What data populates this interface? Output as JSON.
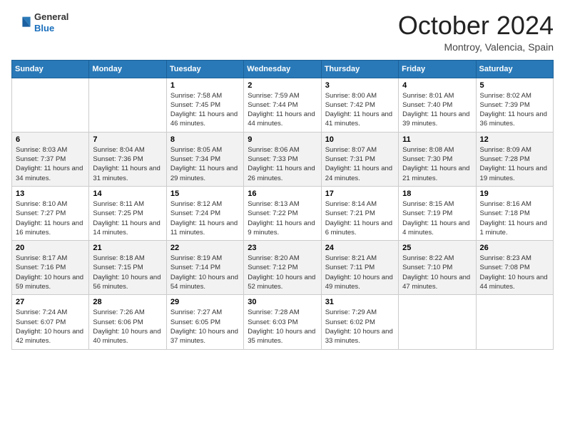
{
  "header": {
    "logo_general": "General",
    "logo_blue": "Blue",
    "month_title": "October 2024",
    "location": "Montroy, Valencia, Spain"
  },
  "weekdays": [
    "Sunday",
    "Monday",
    "Tuesday",
    "Wednesday",
    "Thursday",
    "Friday",
    "Saturday"
  ],
  "weeks": [
    [
      {
        "day": "",
        "sunrise": "",
        "sunset": "",
        "daylight": ""
      },
      {
        "day": "",
        "sunrise": "",
        "sunset": "",
        "daylight": ""
      },
      {
        "day": "1",
        "sunrise": "Sunrise: 7:58 AM",
        "sunset": "Sunset: 7:45 PM",
        "daylight": "Daylight: 11 hours and 46 minutes."
      },
      {
        "day": "2",
        "sunrise": "Sunrise: 7:59 AM",
        "sunset": "Sunset: 7:44 PM",
        "daylight": "Daylight: 11 hours and 44 minutes."
      },
      {
        "day": "3",
        "sunrise": "Sunrise: 8:00 AM",
        "sunset": "Sunset: 7:42 PM",
        "daylight": "Daylight: 11 hours and 41 minutes."
      },
      {
        "day": "4",
        "sunrise": "Sunrise: 8:01 AM",
        "sunset": "Sunset: 7:40 PM",
        "daylight": "Daylight: 11 hours and 39 minutes."
      },
      {
        "day": "5",
        "sunrise": "Sunrise: 8:02 AM",
        "sunset": "Sunset: 7:39 PM",
        "daylight": "Daylight: 11 hours and 36 minutes."
      }
    ],
    [
      {
        "day": "6",
        "sunrise": "Sunrise: 8:03 AM",
        "sunset": "Sunset: 7:37 PM",
        "daylight": "Daylight: 11 hours and 34 minutes."
      },
      {
        "day": "7",
        "sunrise": "Sunrise: 8:04 AM",
        "sunset": "Sunset: 7:36 PM",
        "daylight": "Daylight: 11 hours and 31 minutes."
      },
      {
        "day": "8",
        "sunrise": "Sunrise: 8:05 AM",
        "sunset": "Sunset: 7:34 PM",
        "daylight": "Daylight: 11 hours and 29 minutes."
      },
      {
        "day": "9",
        "sunrise": "Sunrise: 8:06 AM",
        "sunset": "Sunset: 7:33 PM",
        "daylight": "Daylight: 11 hours and 26 minutes."
      },
      {
        "day": "10",
        "sunrise": "Sunrise: 8:07 AM",
        "sunset": "Sunset: 7:31 PM",
        "daylight": "Daylight: 11 hours and 24 minutes."
      },
      {
        "day": "11",
        "sunrise": "Sunrise: 8:08 AM",
        "sunset": "Sunset: 7:30 PM",
        "daylight": "Daylight: 11 hours and 21 minutes."
      },
      {
        "day": "12",
        "sunrise": "Sunrise: 8:09 AM",
        "sunset": "Sunset: 7:28 PM",
        "daylight": "Daylight: 11 hours and 19 minutes."
      }
    ],
    [
      {
        "day": "13",
        "sunrise": "Sunrise: 8:10 AM",
        "sunset": "Sunset: 7:27 PM",
        "daylight": "Daylight: 11 hours and 16 minutes."
      },
      {
        "day": "14",
        "sunrise": "Sunrise: 8:11 AM",
        "sunset": "Sunset: 7:25 PM",
        "daylight": "Daylight: 11 hours and 14 minutes."
      },
      {
        "day": "15",
        "sunrise": "Sunrise: 8:12 AM",
        "sunset": "Sunset: 7:24 PM",
        "daylight": "Daylight: 11 hours and 11 minutes."
      },
      {
        "day": "16",
        "sunrise": "Sunrise: 8:13 AM",
        "sunset": "Sunset: 7:22 PM",
        "daylight": "Daylight: 11 hours and 9 minutes."
      },
      {
        "day": "17",
        "sunrise": "Sunrise: 8:14 AM",
        "sunset": "Sunset: 7:21 PM",
        "daylight": "Daylight: 11 hours and 6 minutes."
      },
      {
        "day": "18",
        "sunrise": "Sunrise: 8:15 AM",
        "sunset": "Sunset: 7:19 PM",
        "daylight": "Daylight: 11 hours and 4 minutes."
      },
      {
        "day": "19",
        "sunrise": "Sunrise: 8:16 AM",
        "sunset": "Sunset: 7:18 PM",
        "daylight": "Daylight: 11 hours and 1 minute."
      }
    ],
    [
      {
        "day": "20",
        "sunrise": "Sunrise: 8:17 AM",
        "sunset": "Sunset: 7:16 PM",
        "daylight": "Daylight: 10 hours and 59 minutes."
      },
      {
        "day": "21",
        "sunrise": "Sunrise: 8:18 AM",
        "sunset": "Sunset: 7:15 PM",
        "daylight": "Daylight: 10 hours and 56 minutes."
      },
      {
        "day": "22",
        "sunrise": "Sunrise: 8:19 AM",
        "sunset": "Sunset: 7:14 PM",
        "daylight": "Daylight: 10 hours and 54 minutes."
      },
      {
        "day": "23",
        "sunrise": "Sunrise: 8:20 AM",
        "sunset": "Sunset: 7:12 PM",
        "daylight": "Daylight: 10 hours and 52 minutes."
      },
      {
        "day": "24",
        "sunrise": "Sunrise: 8:21 AM",
        "sunset": "Sunset: 7:11 PM",
        "daylight": "Daylight: 10 hours and 49 minutes."
      },
      {
        "day": "25",
        "sunrise": "Sunrise: 8:22 AM",
        "sunset": "Sunset: 7:10 PM",
        "daylight": "Daylight: 10 hours and 47 minutes."
      },
      {
        "day": "26",
        "sunrise": "Sunrise: 8:23 AM",
        "sunset": "Sunset: 7:08 PM",
        "daylight": "Daylight: 10 hours and 44 minutes."
      }
    ],
    [
      {
        "day": "27",
        "sunrise": "Sunrise: 7:24 AM",
        "sunset": "Sunset: 6:07 PM",
        "daylight": "Daylight: 10 hours and 42 minutes."
      },
      {
        "day": "28",
        "sunrise": "Sunrise: 7:26 AM",
        "sunset": "Sunset: 6:06 PM",
        "daylight": "Daylight: 10 hours and 40 minutes."
      },
      {
        "day": "29",
        "sunrise": "Sunrise: 7:27 AM",
        "sunset": "Sunset: 6:05 PM",
        "daylight": "Daylight: 10 hours and 37 minutes."
      },
      {
        "day": "30",
        "sunrise": "Sunrise: 7:28 AM",
        "sunset": "Sunset: 6:03 PM",
        "daylight": "Daylight: 10 hours and 35 minutes."
      },
      {
        "day": "31",
        "sunrise": "Sunrise: 7:29 AM",
        "sunset": "Sunset: 6:02 PM",
        "daylight": "Daylight: 10 hours and 33 minutes."
      },
      {
        "day": "",
        "sunrise": "",
        "sunset": "",
        "daylight": ""
      },
      {
        "day": "",
        "sunrise": "",
        "sunset": "",
        "daylight": ""
      }
    ]
  ]
}
